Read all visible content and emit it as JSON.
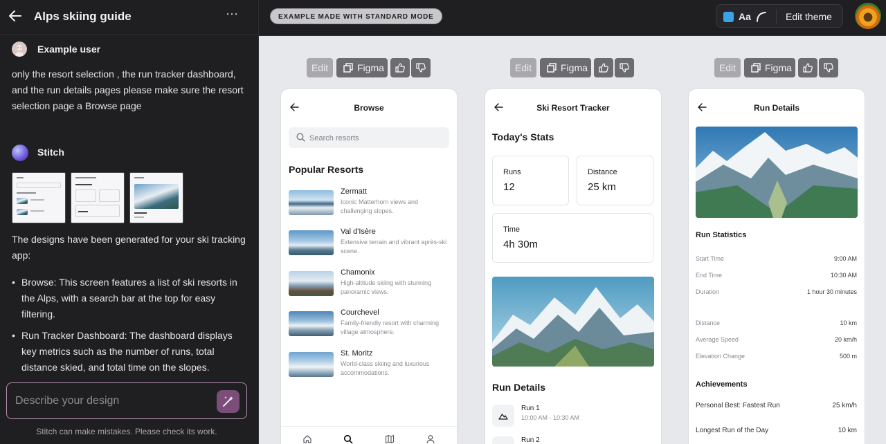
{
  "sidebar": {
    "title": "Alps skiing guide",
    "user_name": "Example user",
    "user_message": "only the resort selection , the run tracker dashboard, and the run details pages please make sure the resort selection page a Browse page",
    "assistant_name": "Stitch",
    "generated_text": "The designs have been generated for your ski tracking app:",
    "bullets": [
      "Browse: This screen features a list of ski resorts in the Alps, with a search bar at the top for easy filtering.",
      "Run Tracker Dashboard: The dashboard displays key metrics such as the number of runs, total distance skied, and total time on the slopes."
    ],
    "input_placeholder": "Describe your design",
    "disclaimer": "Stitch can make mistakes. Please check its work."
  },
  "topbar": {
    "mode_badge": "EXAMPLE MADE WITH STANDARD MODE",
    "font_label": "Aa",
    "edit_theme": "Edit theme",
    "accent": "#3aa3e8"
  },
  "toolbar": {
    "edit_label": "Edit",
    "figma_label": "Figma"
  },
  "browse": {
    "title": "Browse",
    "search_placeholder": "Search resorts",
    "section": "Popular Resorts",
    "resorts": [
      {
        "name": "Zermatt",
        "desc": "Iconic Matterhorn views and challenging slopes."
      },
      {
        "name": "Val d'Isère",
        "desc": "Extensive terrain and vibrant après-ski scene."
      },
      {
        "name": "Chamonix",
        "desc": "High-altitude skiing with stunning panoramic views."
      },
      {
        "name": "Courchevel",
        "desc": "Family-friendly resort with charming village atmosphere."
      },
      {
        "name": "St. Moritz",
        "desc": "World-class skiing and luxurious accommodations."
      }
    ]
  },
  "tracker": {
    "title": "Ski Resort Tracker",
    "section": "Today's Stats",
    "runs_label": "Runs",
    "runs_value": "12",
    "distance_label": "Distance",
    "distance_value": "25 km",
    "time_label": "Time",
    "time_value": "4h 30m",
    "run_details": "Run Details",
    "runs": [
      {
        "name": "Run 1",
        "time": "10:00 AM - 10:30 AM"
      },
      {
        "name": "Run 2",
        "time": ""
      }
    ]
  },
  "details": {
    "title": "Run Details",
    "stats_heading": "Run Statistics",
    "stats": [
      {
        "k": "Start Time",
        "v": "9:00 AM"
      },
      {
        "k": "End Time",
        "v": "10:30 AM"
      },
      {
        "k": "Duration",
        "v": "1 hour 30 minutes"
      },
      {
        "k": "Distance",
        "v": "10 km"
      },
      {
        "k": "Average Speed",
        "v": "20 km/h"
      },
      {
        "k": "Elevation Change",
        "v": "500 m"
      }
    ],
    "achievements_heading": "Achievements",
    "achievements": [
      {
        "k": "Personal Best: Fastest Run",
        "v": "25 km/h"
      },
      {
        "k": "Longest Run of the Day",
        "v": "10 km"
      }
    ]
  }
}
